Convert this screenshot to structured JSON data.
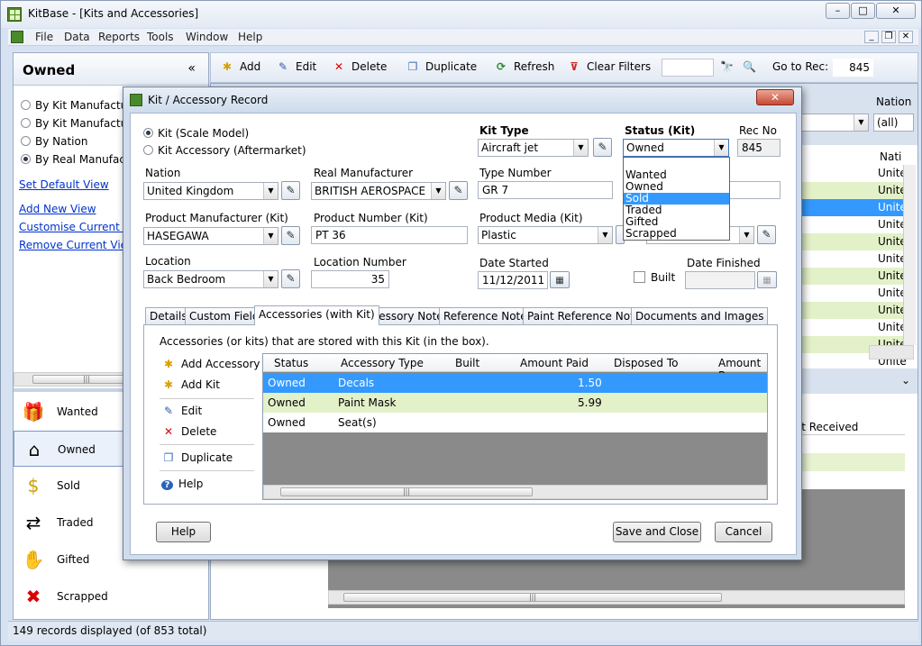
{
  "app": {
    "title": "KitBase - [Kits and Accessories]",
    "window_controls": {
      "minimize": "–",
      "maximize": "□",
      "close": "✕"
    }
  },
  "menu": [
    "File",
    "Data",
    "Reports",
    "Tools",
    "Window",
    "Help"
  ],
  "left_panel": {
    "title": "Owned",
    "collapse": "«",
    "views": [
      {
        "label": "By Kit Manufacturer",
        "selected": false
      },
      {
        "label": "By Kit Manufacturer",
        "selected": false
      },
      {
        "label": "By Nation",
        "selected": false
      },
      {
        "label": "By Real Manufacturer",
        "selected": true
      }
    ],
    "links": [
      "Set Default View",
      "Add New View",
      "Customise Current View",
      "Remove Current View"
    ],
    "nav": [
      {
        "label": "Wanted",
        "icon": "gift-icon"
      },
      {
        "label": "Owned",
        "icon": "house-icon"
      },
      {
        "label": "Sold",
        "icon": "sold-icon"
      },
      {
        "label": "Traded",
        "icon": "traded-icon"
      },
      {
        "label": "Gifted",
        "icon": "gifted-icon"
      },
      {
        "label": "Scrapped",
        "icon": "scrapped-icon"
      }
    ]
  },
  "toolbar": {
    "add": "Add",
    "edit": "Edit",
    "delete": "Delete",
    "duplicate": "Duplicate",
    "refresh": "Refresh",
    "clear_filters": "Clear Filters",
    "goto_label": "Go to Rec:",
    "goto_value": "845"
  },
  "background_grid": {
    "nation_label": "Nation",
    "nation_filter": "(all)",
    "col_header": "Nati",
    "cells": [
      "Unite",
      "Unite",
      "Unite",
      "Unite",
      "Unite",
      "Unite",
      "Unite",
      "Unite",
      "Unite",
      "Unite",
      "Unite",
      "Unite"
    ],
    "lower_header": "unt Received"
  },
  "status": {
    "text": "149 records displayed (of 853 total)"
  },
  "dialog": {
    "title": "Kit / Accessory Record",
    "close": "✕",
    "type_kit": "Kit (Scale Model)",
    "type_accessory": "Kit Accessory (Aftermarket)",
    "kit_type_label": "Kit Type",
    "kit_type_value": "Aircraft jet",
    "status_label": "Status (Kit)",
    "status_value": "Owned",
    "status_options": [
      "Wanted",
      "Owned",
      "Sold",
      "Traded",
      "Gifted",
      "Scrapped"
    ],
    "status_selected_option": "Sold",
    "rec_no_label": "Rec No",
    "rec_no_value": "845",
    "nation_label": "Nation",
    "nation_value": "United Kingdom",
    "real_mfr_label": "Real Manufacturer",
    "real_mfr_value": "BRITISH AEROSPACE",
    "type_number_label": "Type Number",
    "type_number_value": "GR 7",
    "prod_mfr_label": "Product Manufacturer (Kit)",
    "prod_mfr_value": "HASEGAWA",
    "prod_number_label": "Product Number (Kit)",
    "prod_number_value": "PT 36",
    "media_label": "Product Media (Kit)",
    "media_value": "Plastic",
    "location_label": "Location",
    "location_value": "Back Bedroom",
    "location_number_label": "Location Number",
    "location_number_value": "35",
    "date_started_label": "Date Started",
    "date_started_value": "11/12/2011",
    "built_label": "Built",
    "date_finished_label": "Date Finished",
    "tabs": [
      "Details",
      "Custom Fields",
      "Accessories (with Kit)",
      "Accessory Notes",
      "Reference Notes",
      "Paint Reference Notes",
      "Documents and Images"
    ],
    "active_tab": "Accessories (with Kit)",
    "accessories_caption": "Accessories (or kits) that are stored with this Kit (in the box).",
    "actions": [
      "Add Accessory",
      "Add Kit",
      "Edit",
      "Delete",
      "Duplicate",
      "Help"
    ],
    "grid_columns": [
      "Status",
      "Accessory Type",
      "Built",
      "Amount Paid",
      "Disposed To",
      "Amount Re"
    ],
    "grid_rows": [
      {
        "status": "Owned",
        "type": "Decals",
        "amount": "1.50"
      },
      {
        "status": "Owned",
        "type": "Paint Mask",
        "amount": "5.99"
      },
      {
        "status": "Owned",
        "type": "Seat(s)",
        "amount": ""
      }
    ],
    "help_button": "Help",
    "save_button": "Save and Close",
    "cancel_button": "Cancel"
  }
}
